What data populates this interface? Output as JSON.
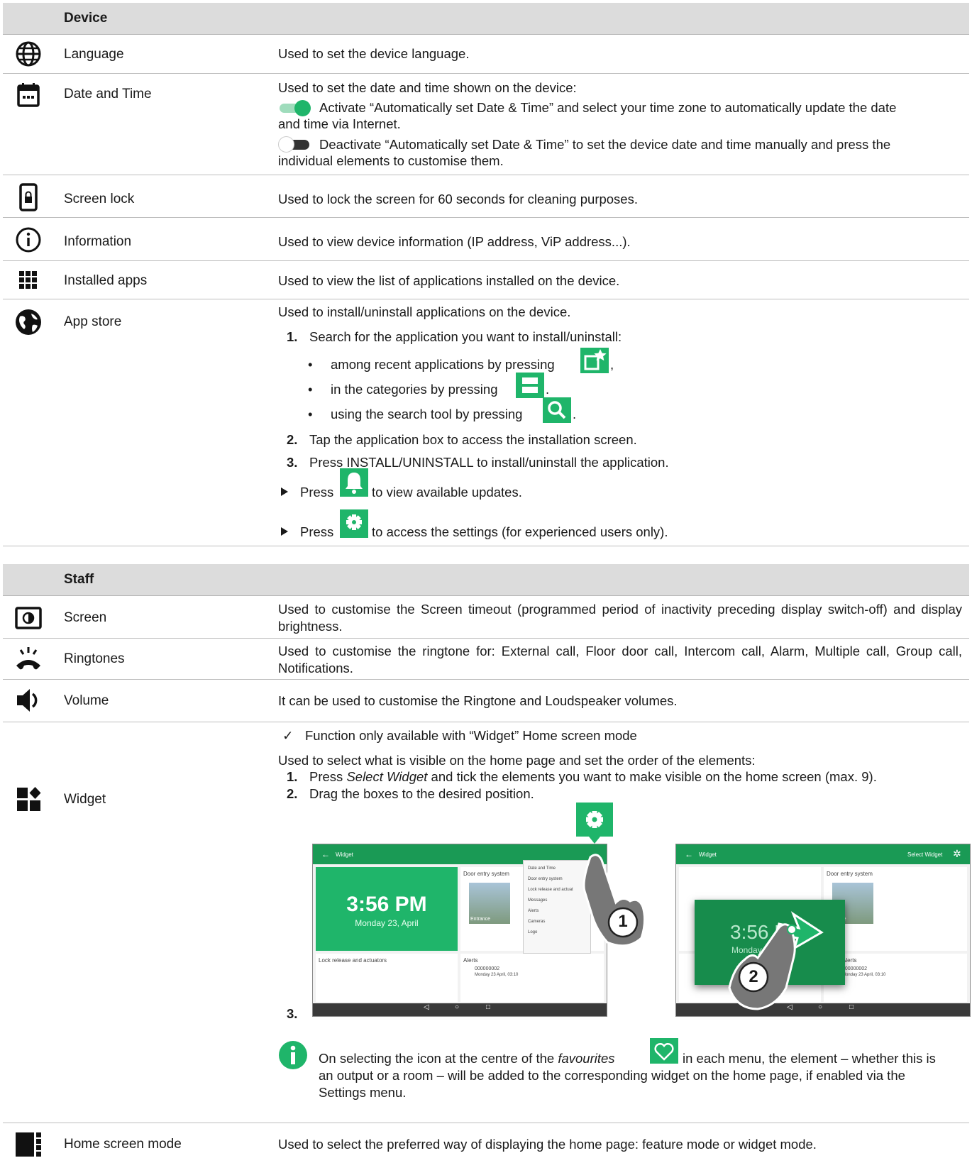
{
  "device_section": {
    "header": "Device",
    "rows": {
      "language": {
        "name": "Language",
        "desc": "Used to set the device language.",
        "icon": "globe-icon"
      },
      "datetime": {
        "name": "Date and Time",
        "desc_intro": "Used to set the date and time shown on the device:",
        "activate_text": "Activate “Automatically set Date & Time” and select your time zone to automatically update the date",
        "activate_text2": "and time via Internet.",
        "deactivate_text": "Deactivate “Automatically set Date & Time” to set the device date and time manually and press the",
        "deactivate_text2": "individual elements to customise them.",
        "icon": "calendar-icon"
      },
      "screen_lock": {
        "name": "Screen lock",
        "desc": "Used to lock the screen for 60 seconds for cleaning purposes.",
        "icon": "lock-phone-icon"
      },
      "information": {
        "name": "Information",
        "desc": "Used to view device information (IP address, ViP address...).",
        "icon": "info-icon"
      },
      "installed_apps": {
        "name": "Installed apps",
        "desc": "Used to view the list of applications installed on the device.",
        "icon": "grid-icon"
      },
      "app_store": {
        "name": "App store",
        "icon": "earth-icon",
        "intro": "Used to install/uninstall applications on the device.",
        "step1_num": "1.",
        "step1": "Search for the application you want to install/uninstall:",
        "bullet1": "among recent applications by pressing",
        "bullet2": "in the categories by pressing",
        "bullet3": "using the search tool by pressing",
        "step2_num": "2.",
        "step2": "Tap the application box to access the installation screen.",
        "step3_num": "3.",
        "step3": "Press INSTALL/UNINSTALL to install/uninstall the application.",
        "press1": "Press",
        "press1_after": "to view available updates.",
        "press2": "Press",
        "press2_after": "to access the settings (for experienced users only)."
      }
    }
  },
  "staff_section": {
    "header": "Staff",
    "rows": {
      "screen": {
        "name": "Screen",
        "desc": "Used to customise the Screen timeout (programmed period of inactivity preceding display switch-off) and display brightness.",
        "icon": "brightness-icon"
      },
      "ringtones": {
        "name": "Ringtones",
        "desc": "Used to customise the ringtone for: External call, Floor door call, Intercom call, Alarm, Multiple call, Group call, Notifications.",
        "icon": "ringing-phone-icon"
      },
      "volume": {
        "name": "Volume",
        "desc": "It can be used to customise the Ringtone and Loudspeaker volumes.",
        "icon": "speaker-icon"
      },
      "widget": {
        "name": "Widget",
        "icon": "widget-icon",
        "check_note": "Function only available with “Widget” Home screen mode",
        "intro": "Used to select what is visible on the home page and set the order of the elements:",
        "step1_num": "1.",
        "step1_a": "Press ",
        "step1_em": "Select Widget",
        "step1_b": " and tick the elements you want to make visible on the home screen (max. 9).",
        "step2_num": "2.",
        "step2": "Drag the boxes to the desired position.",
        "step3_num": "3.",
        "shot1": {
          "title": "Widget",
          "time": "3:56 PM",
          "date": "Monday 23, April",
          "door": "Door entry system",
          "entrance": "Entrance",
          "lock": "Lock release and actuators",
          "alerts": "Alerts",
          "alert_id": "000000002",
          "alert_date": "Monday 23 April, 03:10",
          "menu": [
            "Date and Time",
            "Door entry system",
            "Lock release and actuat",
            "Messages",
            "Alerts",
            "Cameras",
            "Logo"
          ],
          "badge": "1"
        },
        "shot2": {
          "title": "Widget",
          "select": "Select Widget",
          "time": "3:56 PM",
          "date": "Monday 23",
          "door": "Door entry system",
          "entrance": "rance",
          "alerts": "Alerts",
          "alert_id": "000000002",
          "alert_date": "Monday 23 April, 03:10",
          "badge": "2"
        },
        "info_a": "On selecting the icon at the centre of the ",
        "info_em": "favourites",
        "info_b": " in each menu, the element – whether this is",
        "info_line2": "an output or a room – will be added to the corresponding widget on the home page, if enabled via the",
        "info_line3": "Settings menu."
      },
      "home_mode": {
        "name": "Home screen mode",
        "desc": "Used to select the preferred way of displaying the home page: feature mode or widget mode.",
        "icon": "home-mode-icon"
      }
    }
  },
  "colors": {
    "accent": "#1fb56a",
    "header_bg": "#dcdcdc"
  }
}
